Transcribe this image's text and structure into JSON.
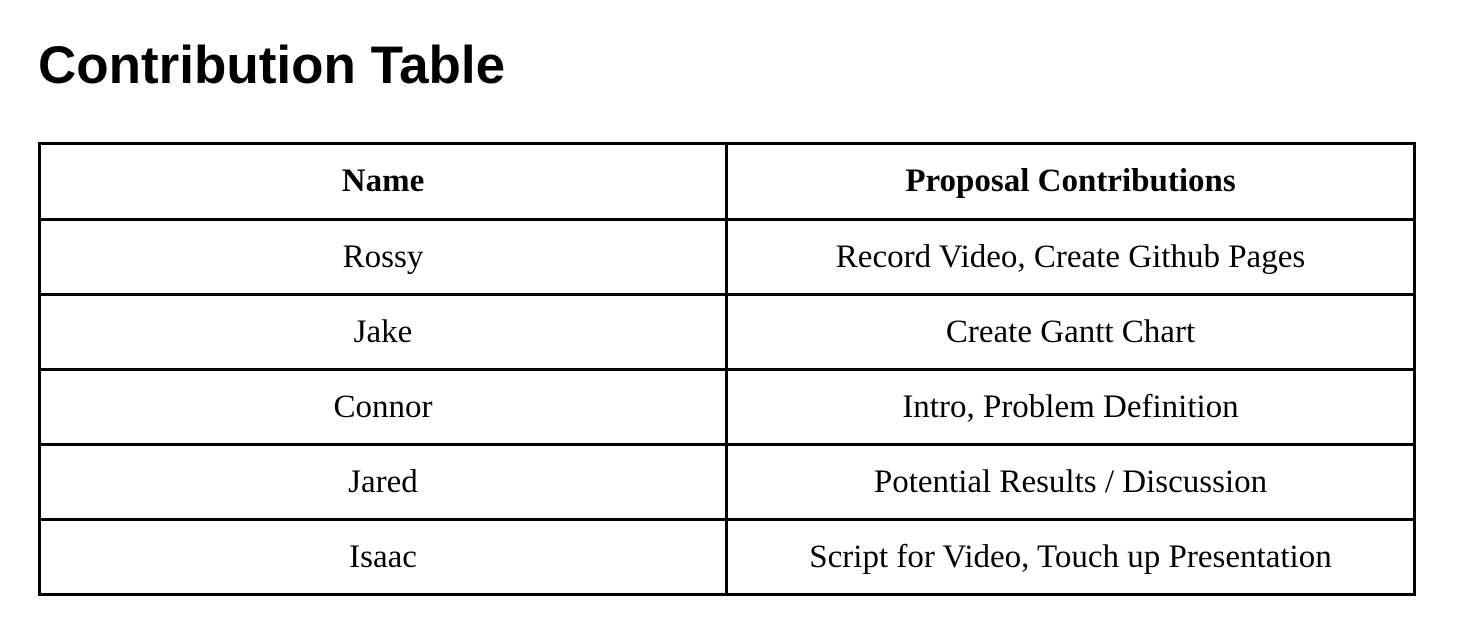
{
  "page": {
    "title": "Contribution Table"
  },
  "table": {
    "headers": [
      "Name",
      "Proposal Contributions"
    ],
    "rows": [
      [
        "Rossy",
        "Record Video, Create Github Pages"
      ],
      [
        "Jake",
        "Create Gantt Chart"
      ],
      [
        "Connor",
        "Intro, Problem Definition"
      ],
      [
        "Jared",
        "Potential Results / Discussion"
      ],
      [
        "Isaac",
        "Script for Video, Touch up Presentation"
      ]
    ]
  },
  "colors": {
    "text": "#000000",
    "border": "#000000",
    "background": "#ffffff"
  }
}
